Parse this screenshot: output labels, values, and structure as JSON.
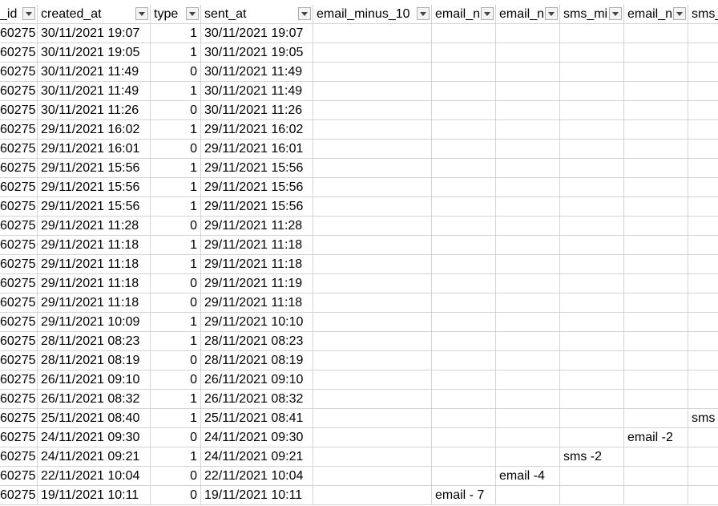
{
  "columns": [
    {
      "label": "_id",
      "filter_icon": "dropdown-arrow-icon"
    },
    {
      "label": "created_at",
      "filter_icon": "dropdown-arrow-icon"
    },
    {
      "label": "type",
      "filter_icon": "dropdown-arrow-icon"
    },
    {
      "label": "sent_at",
      "filter_icon": "dropdown-arrow-icon"
    },
    {
      "label": "email_minus_10",
      "filter_icon": "dropdown-arrow-icon"
    },
    {
      "label": "email_n",
      "filter_icon": "dropdown-arrow-icon"
    },
    {
      "label": "email_n",
      "filter_icon": "dropdown-arrow-icon"
    },
    {
      "label": "sms_mi",
      "filter_icon": "dropdown-arrow-icon"
    },
    {
      "label": "email_n",
      "filter_icon": "dropdown-arrow-icon"
    },
    {
      "label": "sms_",
      "filter_icon": "dropdown-arrow-icon"
    }
  ],
  "rows": [
    [
      "60275",
      "30/11/2021 19:07",
      "1",
      "30/11/2021 19:07",
      "",
      "",
      "",
      "",
      "",
      ""
    ],
    [
      "60275",
      "30/11/2021 19:05",
      "1",
      "30/11/2021 19:05",
      "",
      "",
      "",
      "",
      "",
      ""
    ],
    [
      "60275",
      "30/11/2021 11:49",
      "0",
      "30/11/2021 11:49",
      "",
      "",
      "",
      "",
      "",
      ""
    ],
    [
      "60275",
      "30/11/2021 11:49",
      "1",
      "30/11/2021 11:49",
      "",
      "",
      "",
      "",
      "",
      ""
    ],
    [
      "60275",
      "30/11/2021 11:26",
      "0",
      "30/11/2021 11:26",
      "",
      "",
      "",
      "",
      "",
      ""
    ],
    [
      "60275",
      "29/11/2021 16:02",
      "1",
      "29/11/2021 16:02",
      "",
      "",
      "",
      "",
      "",
      ""
    ],
    [
      "60275",
      "29/11/2021 16:01",
      "0",
      "29/11/2021 16:01",
      "",
      "",
      "",
      "",
      "",
      ""
    ],
    [
      "60275",
      "29/11/2021 15:56",
      "1",
      "29/11/2021 15:56",
      "",
      "",
      "",
      "",
      "",
      ""
    ],
    [
      "60275",
      "29/11/2021 15:56",
      "1",
      "29/11/2021 15:56",
      "",
      "",
      "",
      "",
      "",
      ""
    ],
    [
      "60275",
      "29/11/2021 15:56",
      "1",
      "29/11/2021 15:56",
      "",
      "",
      "",
      "",
      "",
      ""
    ],
    [
      "60275",
      "29/11/2021 11:28",
      "0",
      "29/11/2021 11:28",
      "",
      "",
      "",
      "",
      "",
      ""
    ],
    [
      "60275",
      "29/11/2021 11:18",
      "1",
      "29/11/2021 11:18",
      "",
      "",
      "",
      "",
      "",
      ""
    ],
    [
      "60275",
      "29/11/2021 11:18",
      "1",
      "29/11/2021 11:18",
      "",
      "",
      "",
      "",
      "",
      ""
    ],
    [
      "60275",
      "29/11/2021 11:18",
      "0",
      "29/11/2021 11:19",
      "",
      "",
      "",
      "",
      "",
      ""
    ],
    [
      "60275",
      "29/11/2021 11:18",
      "0",
      "29/11/2021 11:18",
      "",
      "",
      "",
      "",
      "",
      ""
    ],
    [
      "60275",
      "29/11/2021 10:09",
      "1",
      "29/11/2021 10:10",
      "",
      "",
      "",
      "",
      "",
      ""
    ],
    [
      "60275",
      "28/11/2021 08:23",
      "1",
      "28/11/2021 08:23",
      "",
      "",
      "",
      "",
      "",
      ""
    ],
    [
      "60275",
      "28/11/2021 08:19",
      "0",
      "28/11/2021 08:19",
      "",
      "",
      "",
      "",
      "",
      ""
    ],
    [
      "60275",
      "26/11/2021 09:10",
      "0",
      "26/11/2021 09:10",
      "",
      "",
      "",
      "",
      "",
      ""
    ],
    [
      "60275",
      "26/11/2021 08:32",
      "1",
      "26/11/2021 08:32",
      "",
      "",
      "",
      "",
      "",
      ""
    ],
    [
      "60275",
      "25/11/2021 08:40",
      "1",
      "25/11/2021 08:41",
      "",
      "",
      "",
      "",
      "",
      "sms"
    ],
    [
      "60275",
      "24/11/2021 09:30",
      "0",
      "24/11/2021 09:30",
      "",
      "",
      "",
      "",
      "email -2",
      ""
    ],
    [
      "60275",
      "24/11/2021 09:21",
      "1",
      "24/11/2021 09:21",
      "",
      "",
      "",
      "sms -2",
      "",
      ""
    ],
    [
      "60275",
      "22/11/2021 10:04",
      "0",
      "22/11/2021 10:04",
      "",
      "",
      "email -4",
      "",
      "",
      ""
    ],
    [
      "60275",
      "19/11/2021 10:11",
      "0",
      "19/11/2021 10:11",
      "",
      "email - 7",
      "",
      "",
      "",
      ""
    ]
  ],
  "colors": {
    "gridline": "#d4d4d4",
    "filter_button_border": "#aeaeae",
    "filter_button_fill": "#f3f3f3",
    "filter_arrow": "#444444"
  }
}
